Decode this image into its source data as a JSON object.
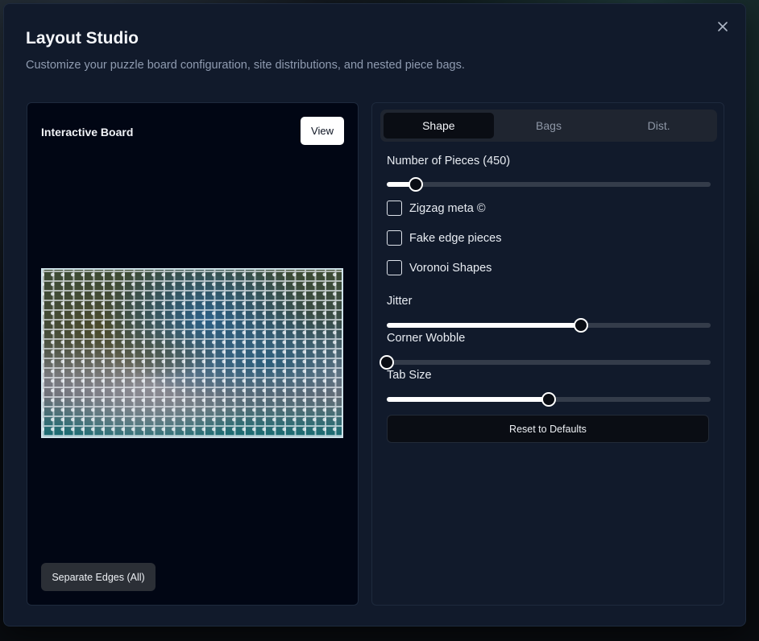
{
  "modal": {
    "title": "Layout Studio",
    "subtitle": "Customize your puzzle board configuration, site distributions, and nested piece bags.",
    "close_icon": "close-icon"
  },
  "board": {
    "label": "Interactive Board",
    "view_button": "View",
    "separate_button": "Separate Edges (All)"
  },
  "tabs": [
    {
      "label": "Shape",
      "active": true
    },
    {
      "label": "Bags",
      "active": false
    },
    {
      "label": "Dist.",
      "active": false
    }
  ],
  "shape": {
    "pieces_label": "Number of Pieces (450)",
    "pieces_fraction": 0.09,
    "checkboxes": [
      {
        "label": "Zigzag meta ©",
        "checked": false
      },
      {
        "label": "Fake edge pieces",
        "checked": false
      },
      {
        "label": "Voronoi Shapes",
        "checked": false
      }
    ],
    "jitter_label": "Jitter",
    "jitter_fraction": 0.6,
    "corner_wobble_label": "Corner Wobble",
    "corner_wobble_fraction": 0.0,
    "tab_size_label": "Tab Size",
    "tab_size_fraction": 0.5,
    "reset_button": "Reset to Defaults"
  },
  "colors": {
    "accent": "#ffffff",
    "panel": "#111a2b",
    "board_bg": "#010614"
  }
}
